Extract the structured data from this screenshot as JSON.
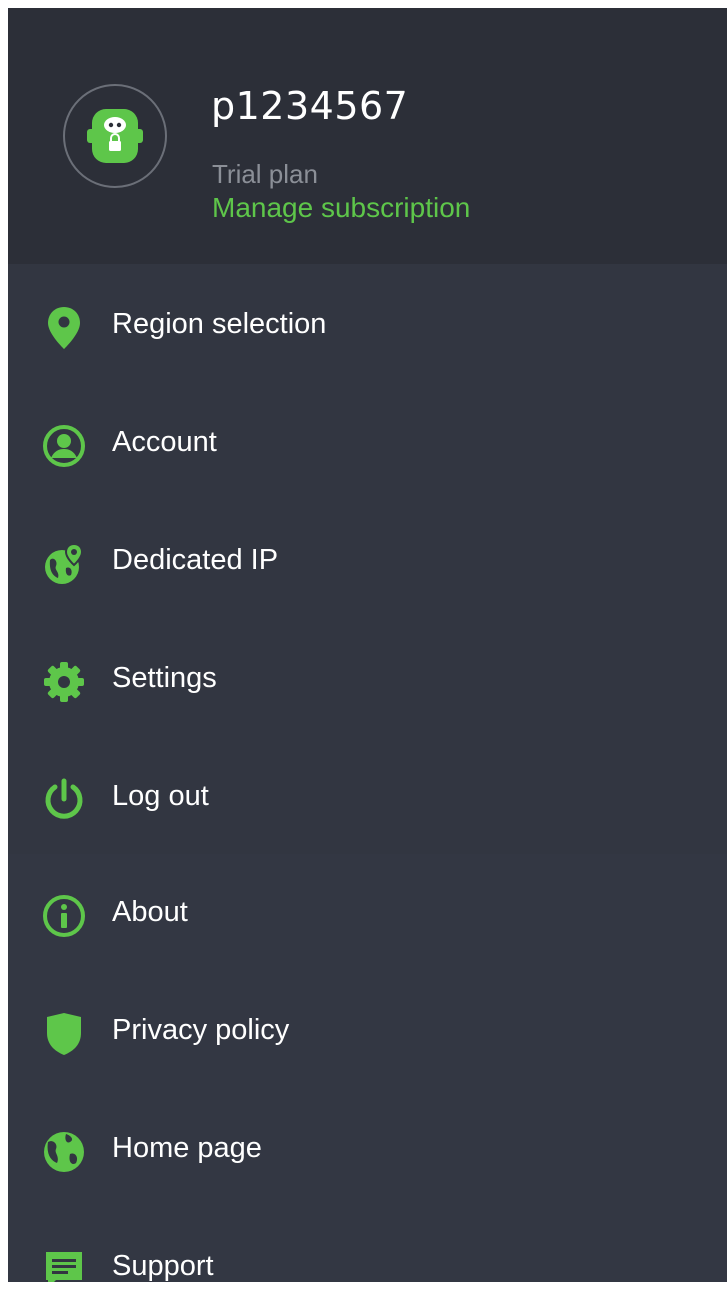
{
  "profile": {
    "username": "p1234567",
    "plan": "Trial plan",
    "manage_link": "Manage subscription"
  },
  "menu": [
    {
      "label": "Region selection",
      "icon": "location-pin-icon"
    },
    {
      "label": "Account",
      "icon": "user-circle-icon"
    },
    {
      "label": "Dedicated IP",
      "icon": "globe-pin-icon"
    },
    {
      "label": "Settings",
      "icon": "gear-icon"
    },
    {
      "label": "Log out",
      "icon": "power-icon"
    }
  ],
  "info_menu": [
    {
      "label": "About",
      "icon": "info-icon"
    },
    {
      "label": "Privacy policy",
      "icon": "shield-icon"
    },
    {
      "label": "Home page",
      "icon": "globe-icon"
    },
    {
      "label": "Support",
      "icon": "chat-icon"
    }
  ],
  "colors": {
    "accent": "#5ec64a",
    "drawer_bg": "#323641",
    "header_bg": "#2c2f38",
    "text": "#ffffff",
    "muted": "#8b8f97"
  }
}
